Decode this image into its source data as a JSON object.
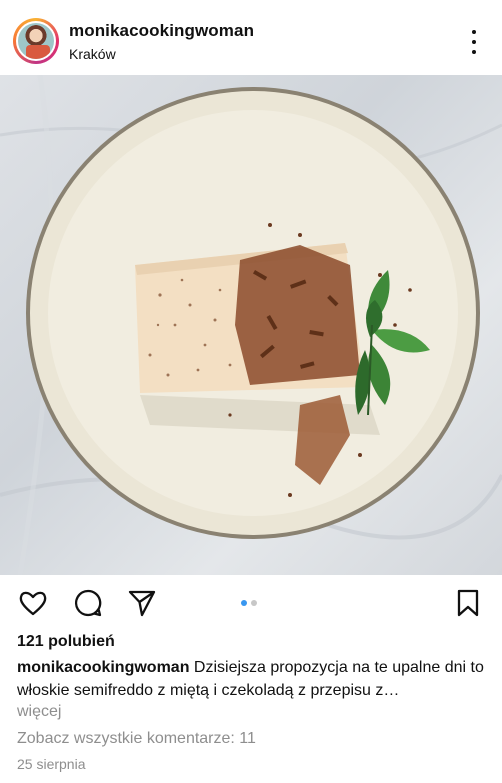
{
  "post": {
    "username": "monikacookingwoman",
    "location": "Kraków",
    "image_alt": "semifreddo z miętą i czekoladą na talerzu",
    "likes": "121 polubień",
    "caption_user": "monikacookingwoman",
    "caption_text": "Dzisiejsza propozycja na te upalne dni to włoskie semifreddo z miętą i czekoladą z przepisu z…",
    "more_label": "więcej",
    "view_comments": "Zobacz wszystkie komentarze: 11",
    "date": "25 sierpnia"
  },
  "carousel": {
    "total": 2,
    "active": 1
  },
  "icons": {
    "more": "more-vertical-icon",
    "like": "heart-icon",
    "comment": "comment-icon",
    "share": "send-icon",
    "save": "bookmark-icon"
  },
  "colors": {
    "text": "#111111",
    "muted": "#8e8e8e",
    "carousel_active": "#3897f0"
  }
}
